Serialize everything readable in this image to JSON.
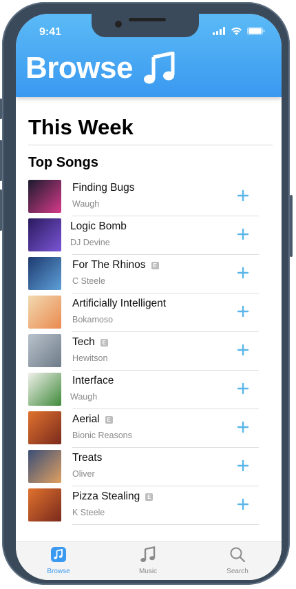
{
  "status_bar": {
    "time": "9:41"
  },
  "header": {
    "title": "Browse"
  },
  "content": {
    "section_title": "This Week",
    "subsection_title": "Top Songs",
    "explicit_badge": "E",
    "songs": [
      {
        "title": "Finding Bugs",
        "artist": "Waugh",
        "explicit": false,
        "art_colors": [
          "#1b1b2e",
          "#d63a8a"
        ]
      },
      {
        "title": "Logic Bomb",
        "artist": "DJ Devine",
        "explicit": false,
        "art_colors": [
          "#2a1a5e",
          "#7b55d6"
        ]
      },
      {
        "title": "For The Rhinos",
        "artist": "C Steele",
        "explicit": true,
        "art_colors": [
          "#1d3a6e",
          "#5ea0d8"
        ]
      },
      {
        "title": "Artificially Intelligent",
        "artist": "Bokamoso",
        "explicit": false,
        "art_colors": [
          "#f2d9b0",
          "#e98a4f"
        ]
      },
      {
        "title": "Tech",
        "artist": "Hewitson",
        "explicit": true,
        "art_colors": [
          "#b8c2cc",
          "#6e7b88"
        ]
      },
      {
        "title": "Interface",
        "artist": "Waugh",
        "explicit": false,
        "art_colors": [
          "#f0f0ea",
          "#3f8a3a"
        ]
      },
      {
        "title": "Aerial",
        "artist": "Bionic Reasons",
        "explicit": true,
        "art_colors": [
          "#e0722e",
          "#7a2a1c"
        ]
      },
      {
        "title": "Treats",
        "artist": "Oliver",
        "explicit": false,
        "art_colors": [
          "#3a4e78",
          "#e0a060"
        ]
      },
      {
        "title": "Pizza Stealing",
        "artist": "K Steele",
        "explicit": true,
        "art_colors": [
          "#e0722e",
          "#7a2a1c"
        ]
      }
    ]
  },
  "tabbar": {
    "tabs": [
      {
        "label": "Browse",
        "icon": "music-note-square-icon",
        "active": true
      },
      {
        "label": "Music",
        "icon": "music-note-icon",
        "active": false
      },
      {
        "label": "Search",
        "icon": "search-icon",
        "active": false
      }
    ]
  },
  "colors": {
    "accent": "#3a99f0",
    "accent_light": "#5bbaf6",
    "add_button": "#5ab6e9",
    "tab_inactive": "#8a8a8a",
    "device_frame": "#3b4a5a"
  }
}
